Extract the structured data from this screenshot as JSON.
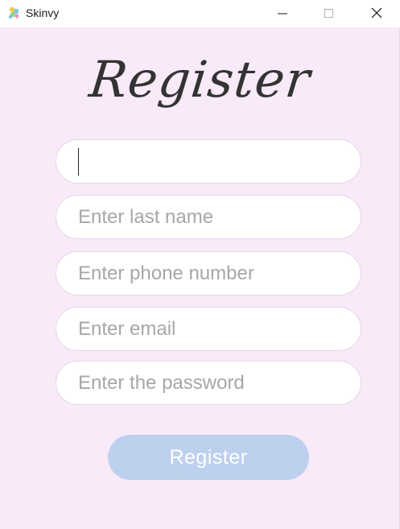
{
  "window": {
    "title": "Skinvy",
    "app_icon": "skinvy-app-icon",
    "controls": {
      "minimize_icon": "minimize-icon",
      "maximize_icon": "maximize-icon",
      "close_icon": "close-icon"
    }
  },
  "form": {
    "heading": "Register",
    "fields": [
      {
        "value": "",
        "placeholder": ""
      },
      {
        "value": "",
        "placeholder": "Enter last name"
      },
      {
        "value": "",
        "placeholder": "Enter phone number"
      },
      {
        "value": "",
        "placeholder": "Enter email"
      },
      {
        "value": "",
        "placeholder": "Enter the password"
      }
    ],
    "submit_label": "Register"
  },
  "colors": {
    "background": "#f8eaf8",
    "field_background": "#ffffff",
    "field_border": "#e3d8e3",
    "placeholder_text": "#a7a7a7",
    "button_background": "#bdd0ee",
    "button_text": "#ffffff",
    "heading_text": "#333333"
  }
}
